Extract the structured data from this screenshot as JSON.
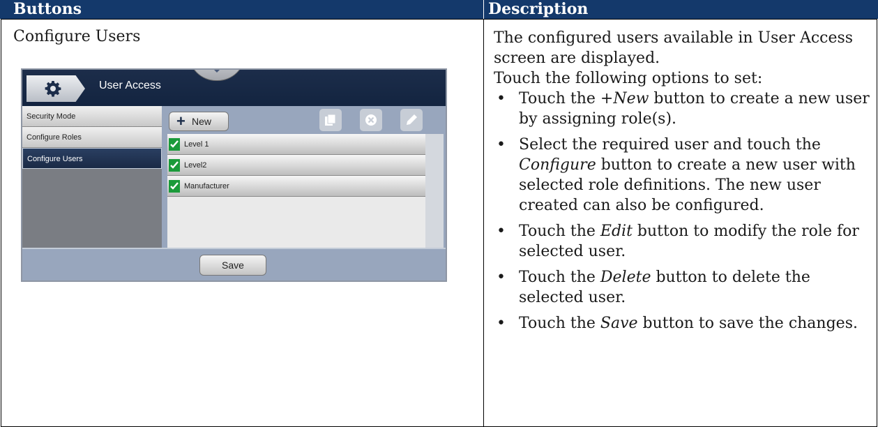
{
  "table": {
    "header_buttons": "Buttons",
    "header_description": "Description"
  },
  "row": {
    "title": "Configure Users",
    "desc_intro": "The configured users available in User Access screen are displayed.",
    "desc_lead": "Touch the following options to set:",
    "bullets": [
      {
        "pre": "Touch the +",
        "em": "New",
        "post": " button to create a new user by assigning role(s)."
      },
      {
        "pre": "Select the required user and touch the ",
        "em": "Configure",
        "post": " button to create a new user with selected role definitions. The new user created can also be configured."
      },
      {
        "pre": "Touch the ",
        "em": "Edit",
        "post": " button to modify the role for selected user."
      },
      {
        "pre": "Touch the ",
        "em": "Delete",
        "post": " button to delete the selected user."
      },
      {
        "pre": "Touch the ",
        "em": "Save",
        "post": " button to save the changes."
      }
    ]
  },
  "device": {
    "breadcrumb": "User Access",
    "sidebar": [
      "Security Mode",
      "Configure Roles",
      "Configure Users"
    ],
    "active_sidebar": "Configure Users",
    "new_button": "New",
    "users": [
      "Level 1",
      "Level2",
      "Manufacturer"
    ],
    "save_button": "Save",
    "icons": [
      "gear-icon",
      "plus-icon",
      "copy-icon",
      "delete-icon",
      "edit-icon",
      "check-icon"
    ],
    "colors": {
      "header": "#14396b",
      "check": "#1a9a3a",
      "panel": "#98a6bd"
    }
  }
}
